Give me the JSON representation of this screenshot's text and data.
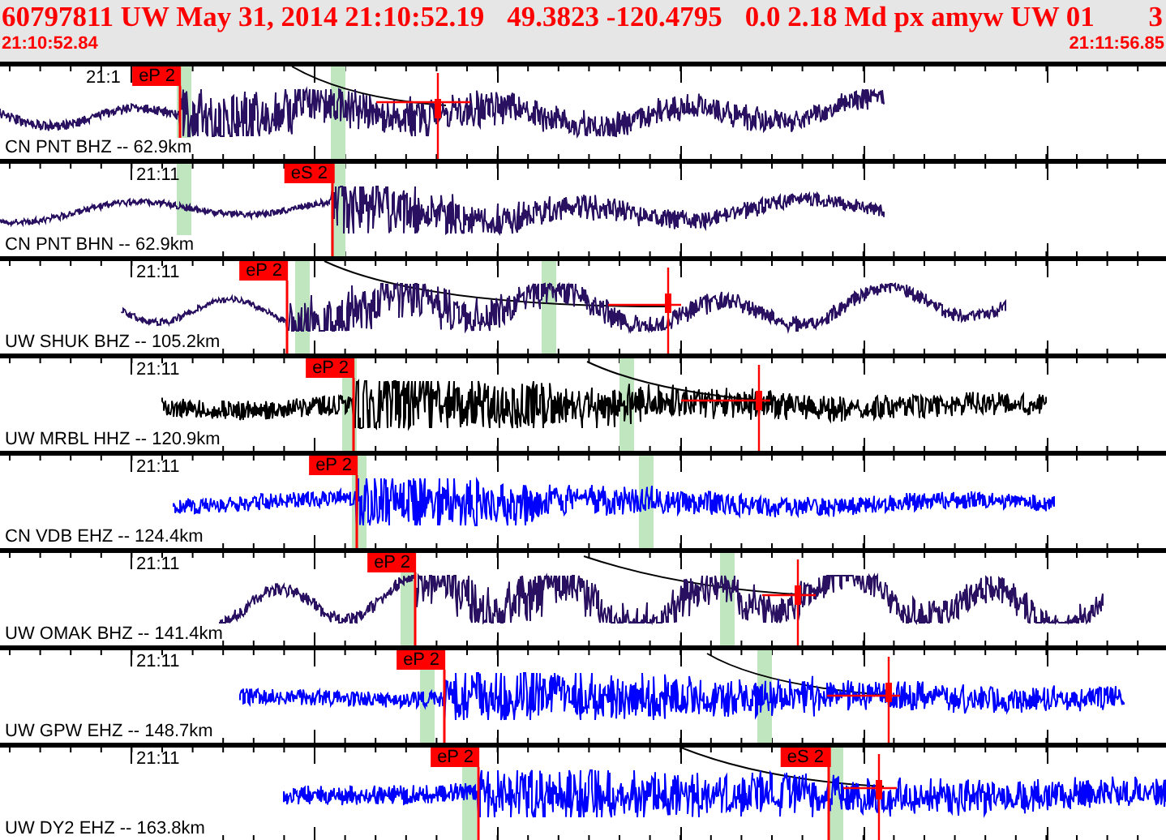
{
  "header": {
    "title_parts": [
      "60797811 UW May 31, 2014 21:10:52.19",
      "49.3823 -120.4795",
      "0.0 2.18 Md px amyw UW 01",
      "3"
    ],
    "start_time": "21:10:52.84",
    "end_time": "21:11:56.85"
  },
  "traces": [
    {
      "label": "CN PNT BHZ -- 62.9km",
      "tick_label": "21:1",
      "color": "#2a1060",
      "picks": [
        {
          "label": "eP 2"
        }
      ]
    },
    {
      "label": "CN PNT BHN -- 62.9km",
      "tick_label": "21:11",
      "color": "#2a1060",
      "picks": [
        {
          "label": "eS 2"
        }
      ]
    },
    {
      "label": "UW SHUK BHZ -- 105.2km",
      "tick_label": "21:11",
      "color": "#2a1060",
      "picks": [
        {
          "label": "eP 2"
        }
      ]
    },
    {
      "label": "UW MRBL HHZ -- 120.9km",
      "tick_label": "21:11",
      "color": "#000000",
      "picks": [
        {
          "label": "eP 2"
        }
      ]
    },
    {
      "label": "CN VDB EHZ -- 124.4km",
      "tick_label": "21:11",
      "color": "#0000ff",
      "picks": [
        {
          "label": "eP 2"
        }
      ]
    },
    {
      "label": "UW OMAK BHZ -- 141.4km",
      "tick_label": "21:11",
      "color": "#2a1060",
      "picks": [
        {
          "label": "eP 2"
        }
      ]
    },
    {
      "label": "UW GPW EHZ -- 148.7km",
      "tick_label": "21:11",
      "color": "#0000ff",
      "picks": [
        {
          "label": "eP 2"
        }
      ]
    },
    {
      "label": "UW DY2 EHZ -- 163.8km",
      "tick_label": "21:11",
      "color": "#0000ff",
      "picks": [
        {
          "label": "eP 2"
        },
        {
          "label": "eS 2"
        }
      ]
    }
  ]
}
